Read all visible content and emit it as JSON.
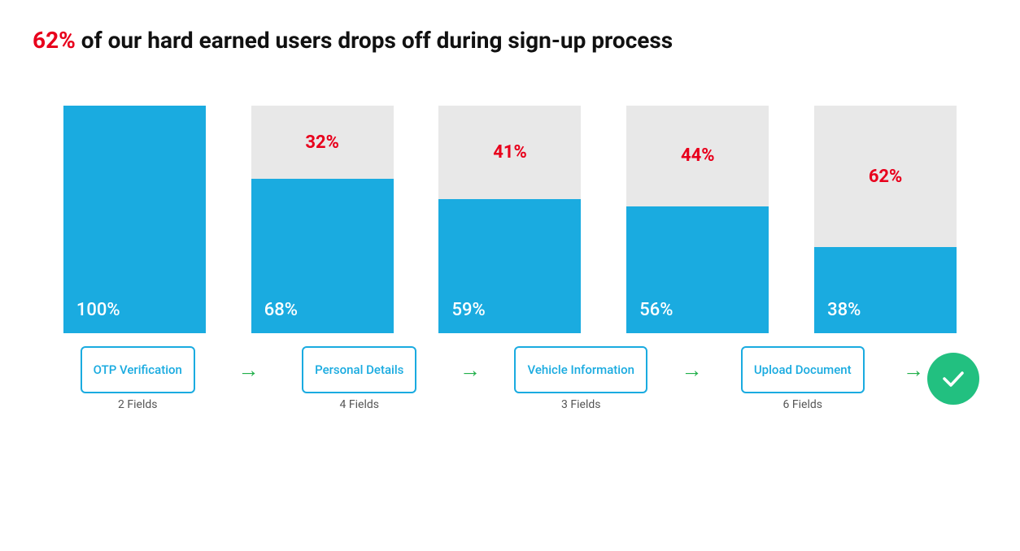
{
  "headline": {
    "prefix": "62%",
    "suffix": " of our hard earned users drops off during sign-up process"
  },
  "bars": [
    {
      "id": "otp",
      "bottom_pct": 100,
      "top_pct": 0,
      "bottom_label": "100%",
      "top_label": null,
      "bottom_height_ratio": 1.0,
      "top_height_ratio": 0.0
    },
    {
      "id": "personal",
      "bottom_pct": 68,
      "top_pct": 32,
      "bottom_label": "68%",
      "top_label": "32%",
      "bottom_height_ratio": 0.68,
      "top_height_ratio": 0.32
    },
    {
      "id": "vehicle",
      "bottom_pct": 59,
      "top_pct": 41,
      "bottom_label": "59%",
      "top_label": "41%",
      "bottom_height_ratio": 0.59,
      "top_height_ratio": 0.41
    },
    {
      "id": "upload",
      "bottom_pct": 56,
      "top_pct": 44,
      "bottom_label": "56%",
      "top_label": "44%",
      "bottom_height_ratio": 0.56,
      "top_height_ratio": 0.44
    },
    {
      "id": "done",
      "bottom_pct": 38,
      "top_pct": 62,
      "bottom_label": "38%",
      "top_label": "62%",
      "bottom_height_ratio": 0.38,
      "top_height_ratio": 0.62
    }
  ],
  "steps": [
    {
      "id": "otp",
      "label": "OTP\nVerification",
      "fields": "2 Fields"
    },
    {
      "id": "personal",
      "label": "Personal Details",
      "fields": "4 Fields"
    },
    {
      "id": "vehicle",
      "label": "Vehicle Information",
      "fields": "3 Fields"
    },
    {
      "id": "upload",
      "label": "Upload Document",
      "fields": "6 Fields"
    }
  ],
  "arrow_char": "→",
  "accent_color": "#1aabe0",
  "red_color": "#e8001c",
  "green_color": "#22c080"
}
